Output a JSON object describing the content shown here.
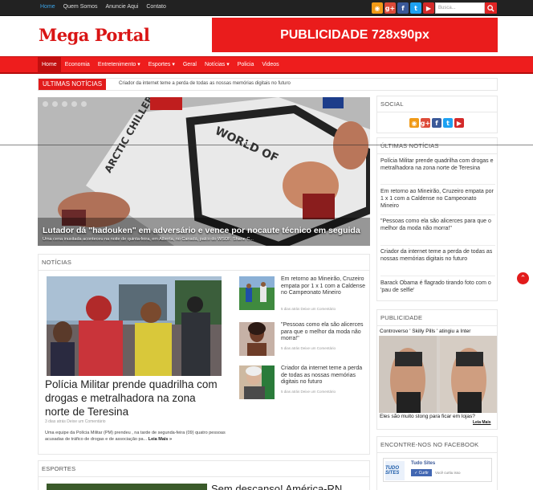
{
  "topbar": {
    "links": [
      "Home",
      "Quem Somos",
      "Anuncie Aqui",
      "Contato"
    ],
    "search_placeholder": "Busca..."
  },
  "social_icons": [
    "rss-icon",
    "google-plus-icon",
    "facebook-icon",
    "twitter-icon",
    "youtube-icon"
  ],
  "header": {
    "logo": "Mega Portal",
    "ad_text": "PUBLICIDADE 728x90px"
  },
  "nav": {
    "items": [
      "Home",
      "Economia",
      "Entretenimento ▾",
      "Esportes ▾",
      "Geral",
      "Notícias ▾",
      "Policia",
      "Videos"
    ]
  },
  "ticker": {
    "label": "ULTIMAS NOTÍCIAS",
    "text": "Criador da internet teme a perda de todas as nossas memórias digitais no futuro"
  },
  "slider": {
    "title": "Lutador dá \"hadouken\" em adversário e vence por nocaute técnico em seguida",
    "subtitle": "Uma cena inusitada aconteceu na noite de quinta-feira, em Alberta, no Canadá, palco do WSOF. Shane C..."
  },
  "noticias": {
    "heading": "NOTÍCIAS",
    "main": {
      "title": "Polícia Militar prende quadrilha com drogas e metralhadora na zona norte de Teresina",
      "meta": "3 dias atrás      Deixe um Comentário",
      "excerpt": "Uma equipe da Polícia Militar (PM) prendeu , na tarde de segunda-feira (09) quatro pessoas acusadas de tráfico de drogas e de associação pa...",
      "more": "Leia Mais »"
    },
    "side": [
      {
        "title": "Em retorno ao Mineirão, Cruzeiro empata por 1 x 1 com a Caldense no Campeonato Mineiro",
        "meta": "5 dias atrás      Deixe um Comentário"
      },
      {
        "title": "\"Pessoas como ela são alicerces para que o melhor da moda não morra!\"",
        "meta": "5 dias atrás      Deixe um Comentário"
      },
      {
        "title": "Criador da internet teme a perda de todas as nossas memórias digitais no futuro",
        "meta": "5 dias atrás      Deixe um Comentário"
      }
    ]
  },
  "esportes": {
    "heading": "ESPORTES",
    "title": "Sem descanso! América-RN"
  },
  "sidebar": {
    "social_heading": "SOCIAL",
    "ultimas_heading": "ÚLTIMAS NOTÍCIAS",
    "ultimas": [
      "Polícia Militar prende quadrilha com drogas e metralhadora na zona norte de Teresina",
      "Em retorno ao Mineirão, Cruzeiro empata por 1 x 1 com a Caldense no Campeonato Mineiro",
      "\"Pessoas como ela são alicerces para que o melhor da moda não morra!\"",
      "Criador da internet teme a perda de todas as nossas memórias digitais no futuro",
      "Barack Obama é flagrado tirando foto com o 'pau de selfie'"
    ],
    "publicidade_heading": "PUBLICIDADE",
    "pub_top": "Controverso ' Skilly Pills ' atingiu a Inter",
    "pub_bottom": "Eles são muito stong para ficar em lojas?",
    "pub_more": "Leia Mais",
    "facebook_heading": "ENCONTRE-NOS NO FACEBOOK",
    "fb_logo": "TUDO SITES",
    "fb_name": "Tudo Sites",
    "fb_button": "✓ Curtir",
    "fb_count": "Você curtiu isso"
  },
  "colors": {
    "brand_red": "#e21b1b",
    "topbar": "#222222"
  }
}
